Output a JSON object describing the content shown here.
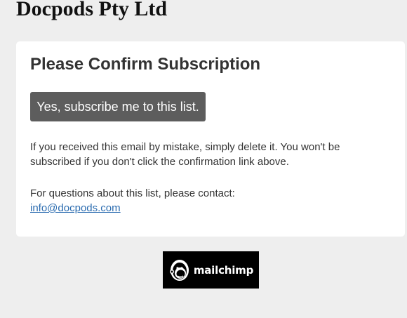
{
  "header": {
    "org_name": "Docpods Pty Ltd"
  },
  "card": {
    "title": "Please Confirm Subscription",
    "confirm_button": "Yes, subscribe me to this list.",
    "mistake_message": "If you received this email by mistake, simply delete it. You won't be subscribed if you don't click the confirmation link above.",
    "contact_prompt": "For questions about this list, please contact:",
    "contact_email": "info@docpods.com"
  },
  "footer": {
    "badge_text": "mailchimp",
    "badge_icon": "mailchimp-freddie-icon"
  },
  "colors": {
    "background": "#eeeeee",
    "card": "#ffffff",
    "button": "#5d5d5d",
    "link": "#2b6cb0",
    "badge": "#000000"
  }
}
